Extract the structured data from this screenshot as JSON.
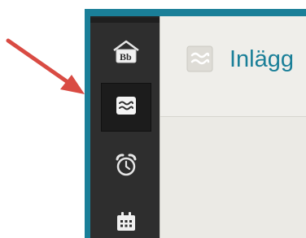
{
  "sidebar": {
    "items": [
      {
        "name": "home",
        "icon": "blackboard-home-icon",
        "badge": "Bb",
        "active": false
      },
      {
        "name": "posts",
        "icon": "waves-icon",
        "active": true
      },
      {
        "name": "alarms",
        "icon": "alarm-clock-icon",
        "active": false
      },
      {
        "name": "calendar",
        "icon": "calendar-icon",
        "active": false
      }
    ]
  },
  "header": {
    "icon": "waves-icon",
    "title": "Inlägg"
  },
  "colors": {
    "accent": "#1a7f98",
    "sidebar_bg": "#2e2e2e",
    "active_item_bg": "#1c1c1c",
    "main_bg": "#efeeea",
    "annotation_arrow": "#d94b43"
  }
}
